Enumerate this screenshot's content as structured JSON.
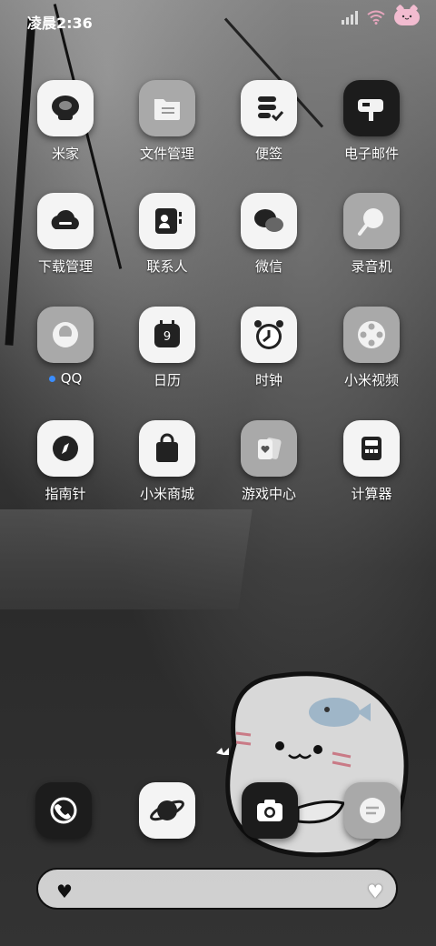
{
  "status_bar": {
    "time": "凌晨2:36"
  },
  "apps": [
    {
      "label": "米家",
      "icon": "mijia-icon"
    },
    {
      "label": "文件管理",
      "icon": "folder-icon"
    },
    {
      "label": "便签",
      "icon": "notes-icon"
    },
    {
      "label": "电子邮件",
      "icon": "mailbox-icon"
    },
    {
      "label": "下载管理",
      "icon": "cloud-download-icon"
    },
    {
      "label": "联系人",
      "icon": "contacts-icon"
    },
    {
      "label": "微信",
      "icon": "wechat-icon"
    },
    {
      "label": "录音机",
      "icon": "recorder-icon"
    },
    {
      "label": "QQ",
      "icon": "qq-icon"
    },
    {
      "label": "日历",
      "icon": "calendar-icon"
    },
    {
      "label": "时钟",
      "icon": "alarm-clock-icon"
    },
    {
      "label": "小米视频",
      "icon": "film-reel-icon"
    },
    {
      "label": "指南针",
      "icon": "compass-icon"
    },
    {
      "label": "小米商城",
      "icon": "shopping-bag-icon"
    },
    {
      "label": "游戏中心",
      "icon": "playing-cards-icon"
    },
    {
      "label": "计算器",
      "icon": "calculator-icon"
    }
  ],
  "calendar_day": "9",
  "dock": [
    {
      "icon": "phone-icon"
    },
    {
      "icon": "browser-planet-icon"
    },
    {
      "icon": "camera-icon"
    },
    {
      "icon": "messages-icon"
    }
  ],
  "search": {
    "left_icon": "heart-icon",
    "right_icon": "heart-outline-icon"
  },
  "colors": {
    "notification_dot": "#3a8dff",
    "battery_pink": "#f2bcd0"
  }
}
